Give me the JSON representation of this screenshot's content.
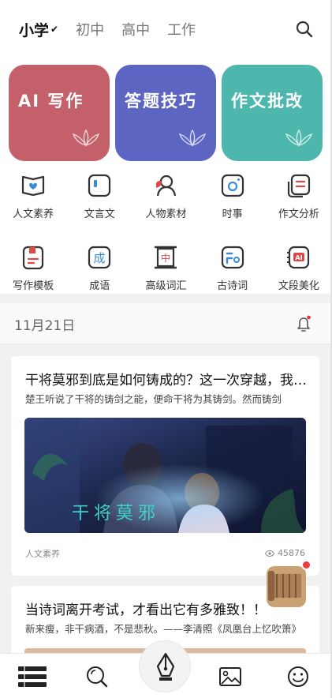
{
  "header": {
    "levels": [
      "小学",
      "初中",
      "高中",
      "工作"
    ],
    "active_check": "✔"
  },
  "cards": [
    {
      "label": "AI 写作",
      "color": "#c4606a"
    },
    {
      "label": "答题技巧",
      "color": "#5c66c2"
    },
    {
      "label": "作文批改",
      "color": "#4db6ad"
    }
  ],
  "grid": [
    {
      "label": "人文素养",
      "icon": "book-heart-icon"
    },
    {
      "label": "文言文",
      "icon": "classical-text-icon"
    },
    {
      "label": "人物素材",
      "icon": "person-icon"
    },
    {
      "label": "时事",
      "icon": "camera-news-icon"
    },
    {
      "label": "作文分析",
      "icon": "document-analysis-icon"
    },
    {
      "label": "写作模板",
      "icon": "template-icon"
    },
    {
      "label": "成语",
      "icon": "idiom-icon"
    },
    {
      "label": "高级词汇",
      "icon": "vocabulary-icon"
    },
    {
      "label": "古诗词",
      "icon": "poetry-icon"
    },
    {
      "label": "文段美化",
      "icon": "ai-polish-icon"
    }
  ],
  "date_bar": {
    "date": "11月21日"
  },
  "articles": [
    {
      "title": "干将莫邪到底是如何铸成的？这一次穿越，我们亲眼",
      "summary": "楚王听说了干将的铸剑之能，便命干将为其铸剑。然而铸剑",
      "image_caption": "干将莫邪",
      "tag": "人文素养",
      "views": "45876"
    },
    {
      "title": "当诗词离开考试，才看出它有多雅致！！",
      "summary": "新来瘦，非干病酒，不是悲秋。——李清照《凤凰台上忆吹箫》"
    }
  ],
  "tabbar": {
    "tabs": [
      "library-icon",
      "search-icon",
      "pen-icon",
      "gallery-icon",
      "smile-icon"
    ]
  },
  "colors": {
    "accent_red": "#ee3b3b",
    "icon_stroke": "#333333"
  }
}
